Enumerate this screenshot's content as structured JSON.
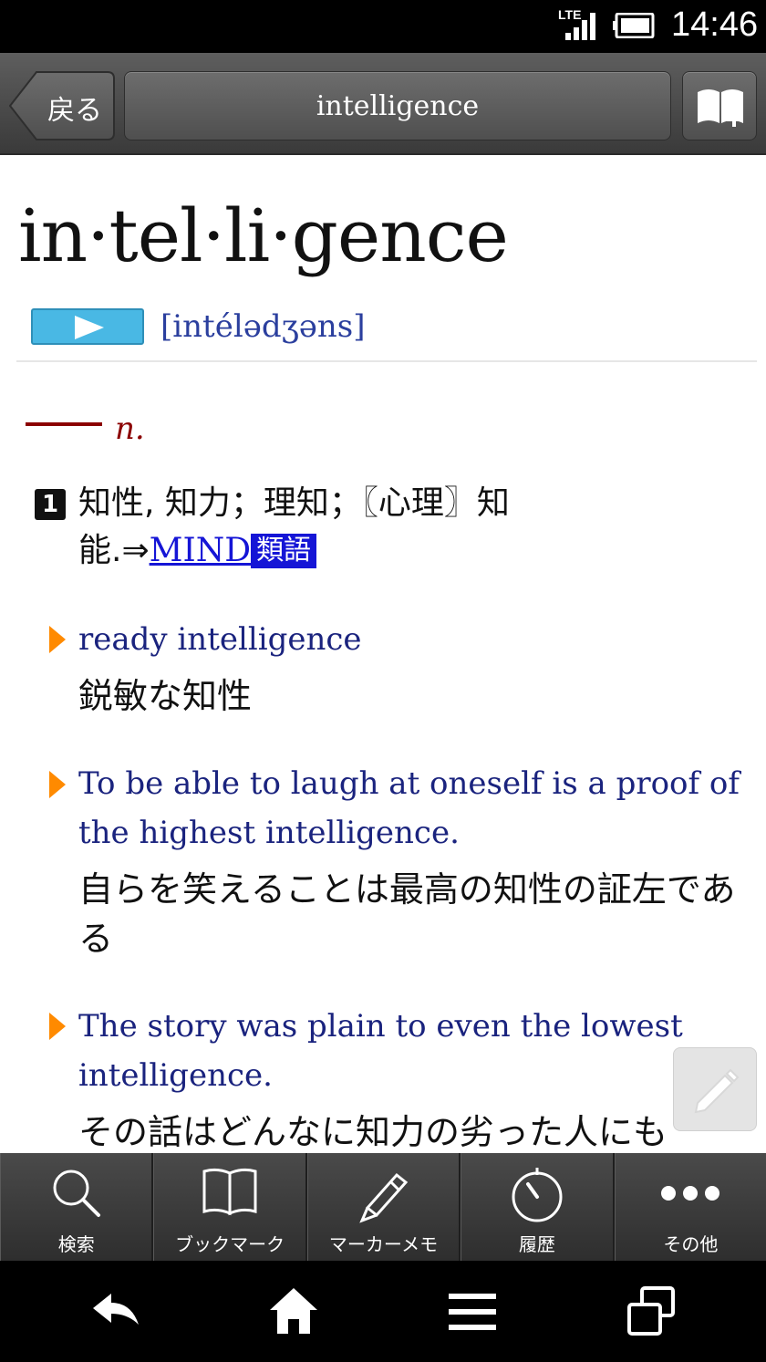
{
  "status_bar": {
    "network": "LTE",
    "time": "14:46"
  },
  "toolbar": {
    "back_label": "戻る",
    "title": "intelligence"
  },
  "entry": {
    "headword": "in·tel·li·gence",
    "pronunciation": "[intélədʒəns]",
    "part_of_speech": "n.",
    "sense_number": "1",
    "sense_definition": "知性, 知力；理知；〖心理〗知能.⇒",
    "cross_ref_link": "MIND",
    "cross_ref_tag": "類語",
    "examples": [
      {
        "en": "ready intelligence",
        "ja": "鋭敏な知性"
      },
      {
        "en": "To be able to laugh at oneself is a proof of the highest intelligence.",
        "ja": "自らを笑えることは最高の知性の証左である"
      },
      {
        "en": "The story was plain to even the lowest intelligence.",
        "ja": "その話はどんなに知力の劣った人にも"
      }
    ]
  },
  "tabs": [
    {
      "label": "検索",
      "icon": "search-icon"
    },
    {
      "label": "ブックマーク",
      "icon": "book-icon"
    },
    {
      "label": "マーカーメモ",
      "icon": "pen-icon"
    },
    {
      "label": "履歴",
      "icon": "history-icon"
    },
    {
      "label": "その他",
      "icon": "more-icon"
    }
  ],
  "colors": {
    "accent_blue": "#49b8e4",
    "link_blue": "#1515d6",
    "pos_red": "#8b0000",
    "example_navy": "#1a237e",
    "marker_orange": "#ff8a00"
  }
}
